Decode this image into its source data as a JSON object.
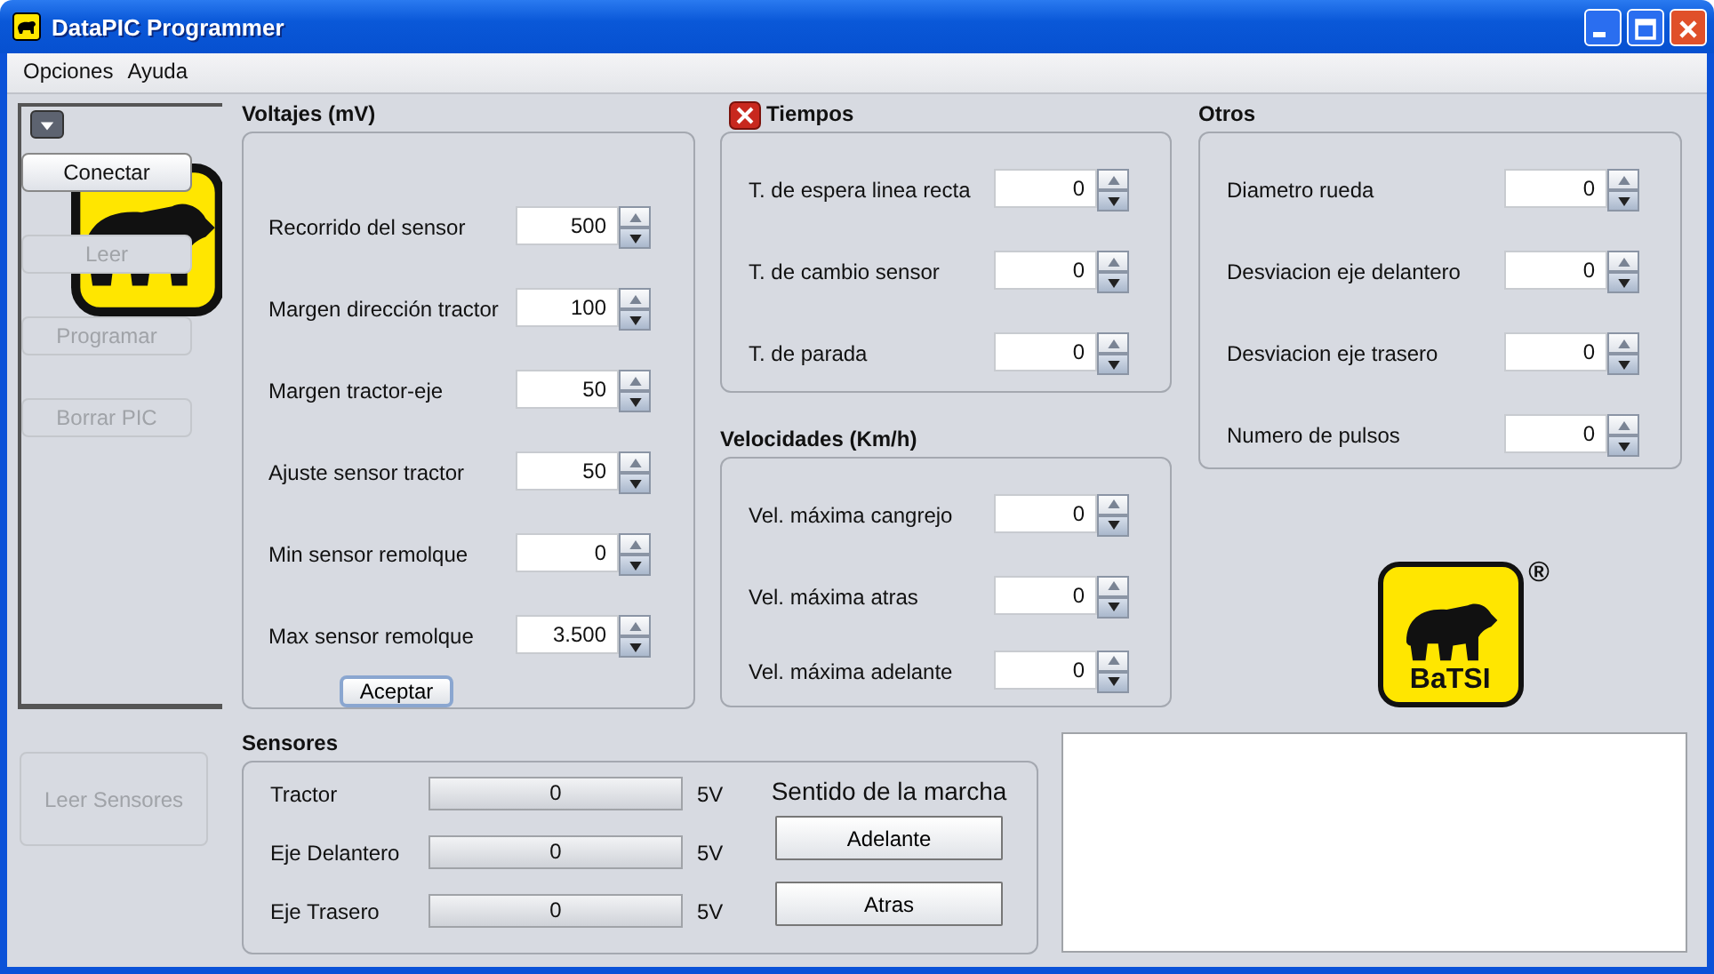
{
  "window": {
    "title": "DataPIC Programmer"
  },
  "menu": [
    {
      "label": "Opciones"
    },
    {
      "label": "Ayuda"
    }
  ],
  "sidebar": {
    "buttons": [
      {
        "label": "Conectar",
        "disabled": false
      },
      {
        "label": "Leer",
        "disabled": true
      },
      {
        "label": "Programar",
        "disabled": true
      },
      {
        "label": "Borrar PIC",
        "disabled": true
      }
    ]
  },
  "voltajes": {
    "title": "Voltajes (mV)",
    "fields": [
      {
        "label": "Recorrido del sensor",
        "value": "500"
      },
      {
        "label": "Margen dirección tractor",
        "value": "100"
      },
      {
        "label": "Margen tractor-eje",
        "value": "50"
      },
      {
        "label": "Ajuste sensor tractor",
        "value": "50"
      },
      {
        "label": "Min sensor remolque",
        "value": "0"
      },
      {
        "label": "Max sensor remolque",
        "value": "3.500"
      }
    ],
    "button": "Aceptar"
  },
  "tiempos": {
    "title": "Tiempos",
    "fields": [
      {
        "label": "T. de espera linea recta",
        "value": "0"
      },
      {
        "label": "T. de cambio sensor",
        "value": "0"
      },
      {
        "label": "T. de parada",
        "value": "0"
      }
    ]
  },
  "velocidades": {
    "title": "Velocidades (Km/h)",
    "fields": [
      {
        "label": "Vel. máxima cangrejo",
        "value": "0"
      },
      {
        "label": "Vel. máxima atras",
        "value": "0"
      },
      {
        "label": "Vel. máxima adelante",
        "value": "0"
      }
    ]
  },
  "otros": {
    "title": "Otros",
    "fields": [
      {
        "label": "Diametro rueda",
        "value": "0"
      },
      {
        "label": "Desviacion eje delantero",
        "value": "0"
      },
      {
        "label": "Desviacion eje trasero",
        "value": "0"
      },
      {
        "label": "Numero de pulsos",
        "value": "0"
      }
    ]
  },
  "logo": {
    "name": "BaTSI",
    "mark": "®"
  },
  "read_button": {
    "label": "Leer Sensores",
    "disabled": true
  },
  "sensores": {
    "title": "Sensores",
    "rows": [
      {
        "label": "Tractor",
        "level": 0,
        "reading": "0",
        "max": "5V"
      },
      {
        "label": "Eje Delantero",
        "level": 0,
        "reading": "0",
        "max": "5V"
      },
      {
        "label": "Eje Trasero",
        "level": 0,
        "reading": "0",
        "max": "5V"
      }
    ],
    "direction": {
      "title": "Sentido de la marcha",
      "buttons": [
        {
          "label": "Adelante"
        },
        {
          "label": "Atras"
        }
      ]
    }
  }
}
